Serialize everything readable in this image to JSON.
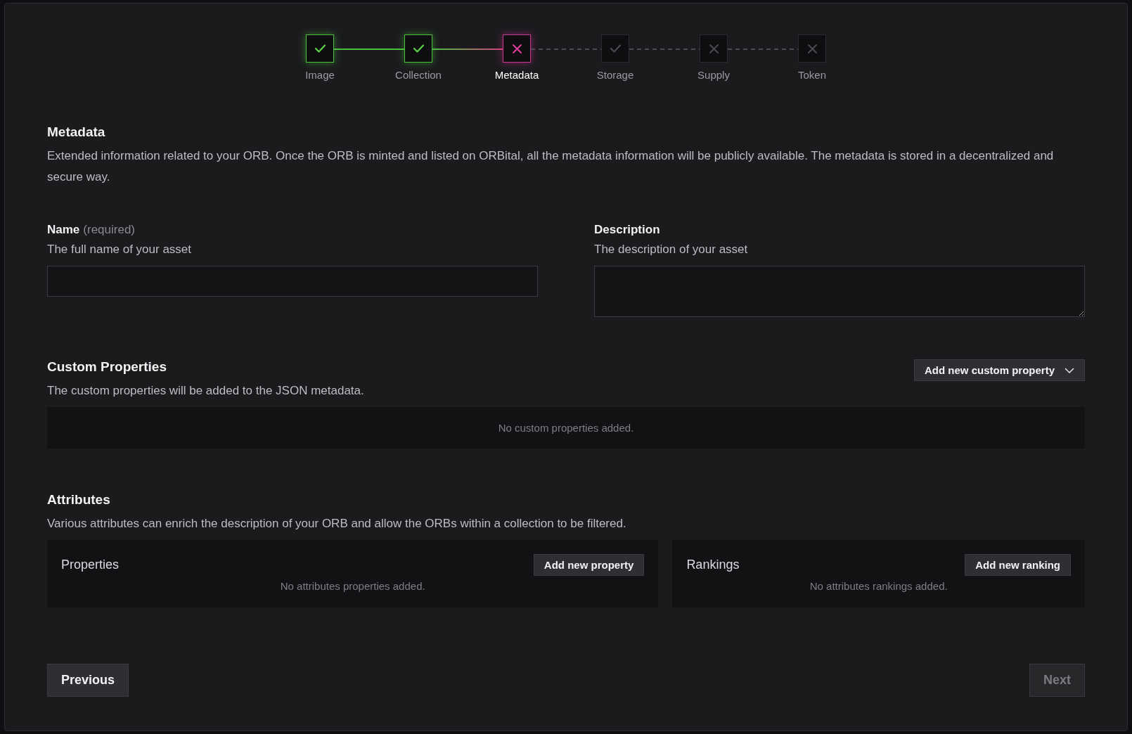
{
  "steps": [
    {
      "label": "Image",
      "kind": "done",
      "checked": true,
      "selected": false
    },
    {
      "label": "Collection",
      "kind": "done",
      "checked": true,
      "selected": false
    },
    {
      "label": "Metadata",
      "kind": "current",
      "checked": false,
      "selected": true
    },
    {
      "label": "Storage",
      "kind": "pending",
      "checked": true,
      "selected": false
    },
    {
      "label": "Supply",
      "kind": "pending",
      "checked": false,
      "selected": false
    },
    {
      "label": "Token",
      "kind": "pending",
      "checked": false,
      "selected": false
    }
  ],
  "heading": "Metadata",
  "intro": "Extended information related to your ORB. Once the ORB is minted and listed on ORBital, all the metadata information will be publicly available. The metadata is stored in a decentralized and secure way.",
  "fields": [
    {
      "kind": "input",
      "label": "Name",
      "note": "(required)",
      "hint": "The full name of your asset"
    },
    {
      "kind": "textarea",
      "label": "Description",
      "hint": "The description of your asset"
    }
  ],
  "custom_properties": {
    "title": "Custom Properties",
    "hint": "The custom properties will be added to the JSON metadata.",
    "button": "Add new custom property",
    "empty": "No custom properties added."
  },
  "attributes": {
    "title": "Attributes",
    "hint": "Various attributes can enrich the description of your ORB and allow the ORBs within a collection to be filtered.",
    "panels": [
      {
        "title": "Properties",
        "button": "Add new property",
        "empty": "No attributes properties added."
      },
      {
        "title": "Rankings",
        "button": "Add new ranking",
        "empty": "No attributes rankings added."
      }
    ]
  },
  "nav": [
    {
      "label": "Previous",
      "disabled": false
    },
    {
      "label": "Next",
      "disabled": true
    }
  ]
}
